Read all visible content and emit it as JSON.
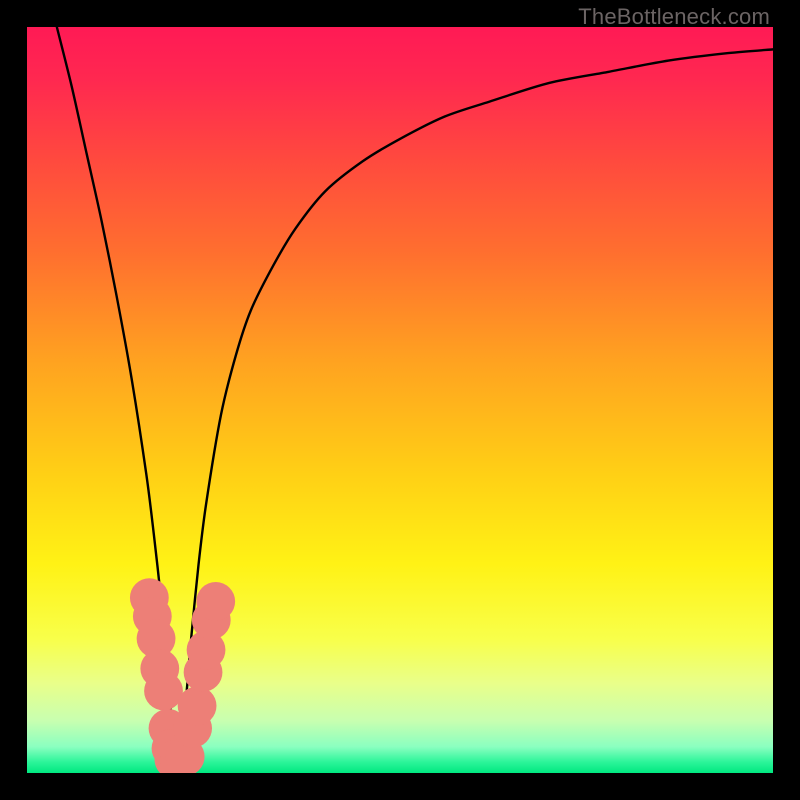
{
  "watermark": "TheBottleneck.com",
  "gradient_stops": [
    {
      "offset": 0.0,
      "color": "#ff1a55"
    },
    {
      "offset": 0.07,
      "color": "#ff2850"
    },
    {
      "offset": 0.18,
      "color": "#ff4a3e"
    },
    {
      "offset": 0.3,
      "color": "#ff6e2f"
    },
    {
      "offset": 0.45,
      "color": "#ffa320"
    },
    {
      "offset": 0.6,
      "color": "#ffd015"
    },
    {
      "offset": 0.72,
      "color": "#fff215"
    },
    {
      "offset": 0.82,
      "color": "#f8ff4a"
    },
    {
      "offset": 0.88,
      "color": "#e9ff8a"
    },
    {
      "offset": 0.93,
      "color": "#c8ffb0"
    },
    {
      "offset": 0.965,
      "color": "#8affc0"
    },
    {
      "offset": 0.985,
      "color": "#2df59a"
    },
    {
      "offset": 1.0,
      "color": "#00e880"
    }
  ],
  "chart_data": {
    "type": "line",
    "title": "",
    "xlabel": "",
    "ylabel": "",
    "xlim": [
      0,
      100
    ],
    "ylim": [
      0,
      100
    ],
    "x_min_at": 20,
    "series": [
      {
        "name": "bottleneck-curve",
        "x": [
          4,
          6,
          8,
          10,
          12,
          14,
          16,
          17,
          18,
          18.5,
          19,
          19.5,
          20,
          20.5,
          21,
          21.5,
          22,
          23,
          24,
          26,
          28,
          30,
          33,
          36,
          40,
          45,
          50,
          56,
          62,
          70,
          78,
          86,
          94,
          100
        ],
        "values": [
          100,
          92,
          83,
          74,
          64,
          53,
          40,
          32,
          23,
          17,
          11,
          6,
          1.5,
          3,
          7,
          12,
          18,
          28,
          36,
          48,
          56,
          62,
          68,
          73,
          78,
          82,
          85,
          88,
          90,
          92.5,
          94,
          95.5,
          96.5,
          97
        ]
      }
    ],
    "marker_clusters": [
      {
        "name": "left-cluster",
        "color": "#ed7f77",
        "points": [
          {
            "x": 16.4,
            "y": 23.5,
            "r": 2.6
          },
          {
            "x": 16.8,
            "y": 21.0,
            "r": 2.6
          },
          {
            "x": 17.3,
            "y": 18.0,
            "r": 2.6
          },
          {
            "x": 17.8,
            "y": 14.0,
            "r": 2.6
          },
          {
            "x": 18.3,
            "y": 11.0,
            "r": 2.6
          },
          {
            "x": 18.9,
            "y": 6.0,
            "r": 2.6
          },
          {
            "x": 19.3,
            "y": 3.3,
            "r": 2.6
          },
          {
            "x": 19.7,
            "y": 1.8,
            "r": 2.6
          },
          {
            "x": 20.4,
            "y": 1.7,
            "r": 2.6
          },
          {
            "x": 21.2,
            "y": 2.2,
            "r": 2.6
          }
        ]
      },
      {
        "name": "right-cluster",
        "color": "#ed7f77",
        "points": [
          {
            "x": 22.2,
            "y": 6.0,
            "r": 2.6
          },
          {
            "x": 22.8,
            "y": 9.0,
            "r": 2.6
          },
          {
            "x": 23.6,
            "y": 13.5,
            "r": 2.6
          },
          {
            "x": 24.0,
            "y": 16.5,
            "r": 2.6
          },
          {
            "x": 24.7,
            "y": 20.5,
            "r": 2.6
          },
          {
            "x": 25.3,
            "y": 23.0,
            "r": 2.6
          }
        ]
      }
    ]
  }
}
